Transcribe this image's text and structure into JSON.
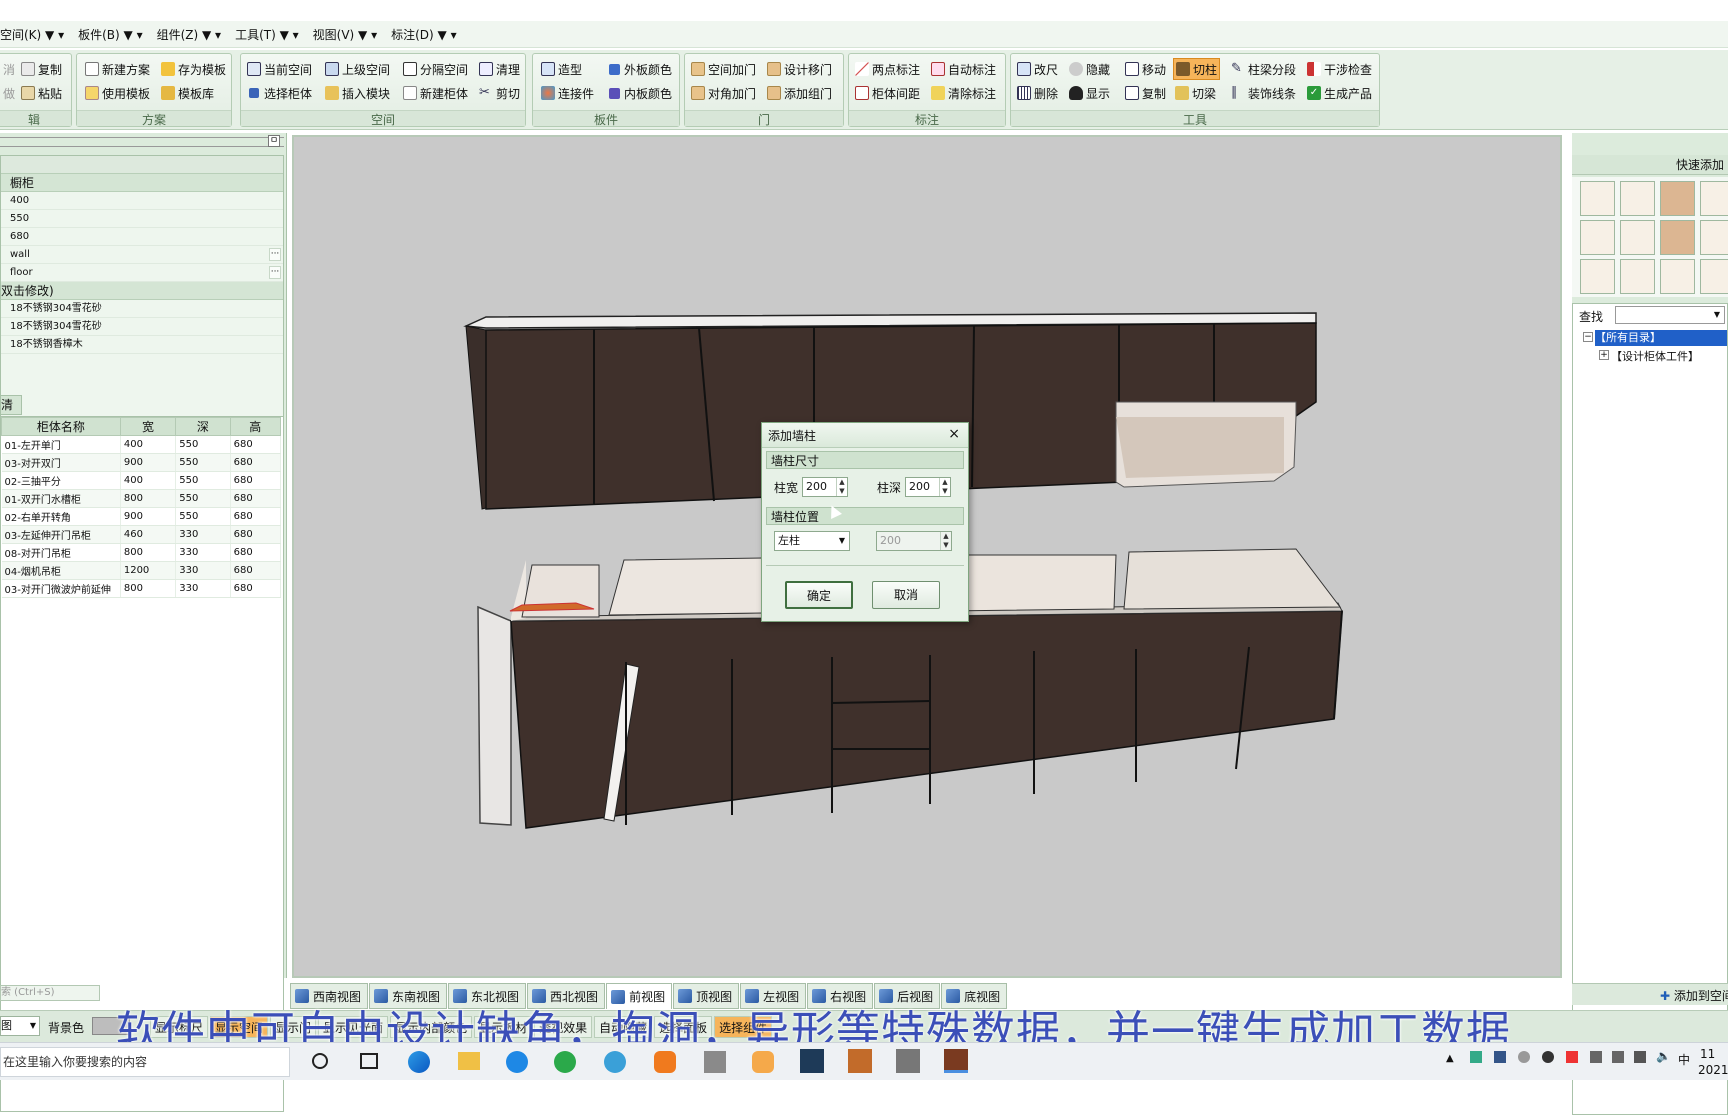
{
  "menu": [
    "空间(K) ▼ ▾",
    "板件(B) ▼ ▾",
    "组件(Z) ▼ ▾",
    "工具(T) ▼ ▾",
    "视图(V) ▼ ▾",
    "标注(D) ▼ ▾"
  ],
  "ribbon": {
    "g0": {
      "label": "辑",
      "b1": "消",
      "b2": "做",
      "b3": "复制",
      "b4": "粘贴"
    },
    "fangan": {
      "label": "方案",
      "b1": "新建方案",
      "b2": "存为模板",
      "b3": "使用模板",
      "b4": "模板库"
    },
    "kongjian": {
      "label": "空间",
      "b1": "当前空间",
      "b2": "上级空间",
      "b3": "分隔空间",
      "b4": "清理",
      "b5": "选择柜体",
      "b6": "插入模块",
      "b7": "新建柜体",
      "b8": "剪切"
    },
    "banjian": {
      "label": "板件",
      "b1": "造型",
      "b2": "外板颜色",
      "b3": "连接件",
      "b4": "内板颜色"
    },
    "men": {
      "label": "门",
      "b1": "空间加门",
      "b2": "设计移门",
      "b3": "对角加门",
      "b4": "添加组门"
    },
    "biaozhu": {
      "label": "标注",
      "b1": "两点标注",
      "b2": "自动标注",
      "b3": "柜体间距",
      "b4": "清除标注"
    },
    "gongju": {
      "label": "工具",
      "b1": "改尺",
      "b2": "隐藏",
      "b3": "移动",
      "b4": "切柱",
      "b5": "柱梁分段",
      "b6": "干涉检查",
      "b7": "删除",
      "b8": "显示",
      "b9": "复制",
      "b10": "切梁",
      "b11": "装饰线条",
      "b12": "生成产品"
    }
  },
  "props": {
    "head1": "橱柜",
    "rows": [
      "400",
      "550",
      "680",
      "wall",
      "floor"
    ],
    "head2": "双击修改)",
    "materials": [
      "18不锈钢304雪花砂",
      "18不锈钢304雪花砂",
      "18不锈钢香樟木"
    ]
  },
  "list": {
    "tab": "清单",
    "headers": [
      "柜体名称",
      "宽",
      "深",
      "高"
    ],
    "rows": [
      [
        "01-左开单门",
        "400",
        "550",
        "680"
      ],
      [
        "03-对开双门",
        "900",
        "550",
        "680"
      ],
      [
        "02-三抽平分",
        "400",
        "550",
        "680"
      ],
      [
        "01-双开门水槽柜",
        "800",
        "550",
        "680"
      ],
      [
        "02-右单开转角",
        "900",
        "550",
        "680"
      ],
      [
        "03-左延伸开门吊柜",
        "460",
        "330",
        "680"
      ],
      [
        "08-对开门吊柜",
        "800",
        "330",
        "680"
      ],
      [
        "04-烟机吊柜",
        "1200",
        "330",
        "680"
      ],
      [
        "03-对开门微波炉前延伸",
        "800",
        "330",
        "680"
      ]
    ],
    "search": "索 (Ctrl+S)"
  },
  "dialog": {
    "title": "添加墙柱",
    "sec1": "墙柱尺寸",
    "width_label": "柱宽",
    "width_value": "200",
    "depth_label": "柱深",
    "depth_value": "200",
    "sec2": "墙柱位置",
    "position_value": "左柱",
    "position_offset": "200",
    "ok": "确定",
    "cancel": "取消"
  },
  "right": {
    "title": "快速添加",
    "search_label": "查找",
    "tree_root": "【所有目录】",
    "tree_child": "【设计柜体工件】",
    "add_button": "添加到空间"
  },
  "views": [
    "西南视图",
    "东南视图",
    "东北视图",
    "西北视图",
    "前视图",
    "顶视图",
    "左视图",
    "右视图",
    "后视图",
    "底视图"
  ],
  "selected_view": "前视图",
  "status": {
    "left": "图",
    "bg_label": "背景色",
    "items": [
      "显示标尺",
      "显示空间",
      "显示门",
      "显示见光面",
      "显示内部颜色",
      "显示板材",
      "透视效果",
      "自动隐藏",
      "选择面板",
      "选择组件"
    ]
  },
  "subtitle": "软件中可自由设计缺角，掏洞，异形等特殊数据，并一键生成加工数据",
  "taskbar": {
    "search": "在这里输入你要搜索的内容",
    "time": "11",
    "date": "2021",
    "ime": "中"
  }
}
